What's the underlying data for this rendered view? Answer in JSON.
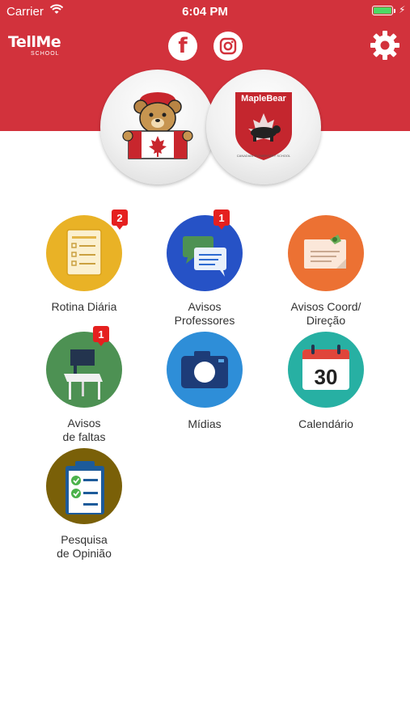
{
  "status_bar": {
    "carrier": "Carrier",
    "time": "6:04 PM"
  },
  "header": {
    "logo_text": "TellMe",
    "logo_sub": "SCHOOL",
    "social": [
      {
        "icon": "facebook-icon",
        "letter": "f"
      },
      {
        "icon": "instagram-icon"
      }
    ],
    "settings_icon": "gear-icon",
    "colors": {
      "header_bg": "#d2323c"
    }
  },
  "schools": [
    {
      "name": "bear-mascot"
    },
    {
      "title": "MapleBear",
      "subtitle": "CANADIAN ELEMENTARY SCHOOL"
    }
  ],
  "menu": [
    {
      "label": "Rotina Diária",
      "badge": "2",
      "color": "#e9b226",
      "icon": "checklist-icon"
    },
    {
      "label": "Avisos\nProfessores",
      "badge": "1",
      "color": "#2652c6",
      "icon": "chat-icon"
    },
    {
      "label": "Avisos Coord/\nDireção",
      "badge": "",
      "color": "#ec7133",
      "icon": "note-icon"
    },
    {
      "label": "Avisos\nde faltas",
      "badge": "1",
      "color": "#4d9153",
      "icon": "school-desk-icon"
    },
    {
      "label": "Mídias",
      "badge": "",
      "color": "#2e8ed8",
      "icon": "camera-icon"
    },
    {
      "label": "Calendário",
      "badge": "",
      "color": "#27b0a3",
      "icon": "calendar-icon",
      "day": "30"
    },
    {
      "label": "Pesquisa\nde Opinião",
      "badge": "",
      "color": "#7a6008",
      "icon": "clipboard-icon"
    }
  ]
}
